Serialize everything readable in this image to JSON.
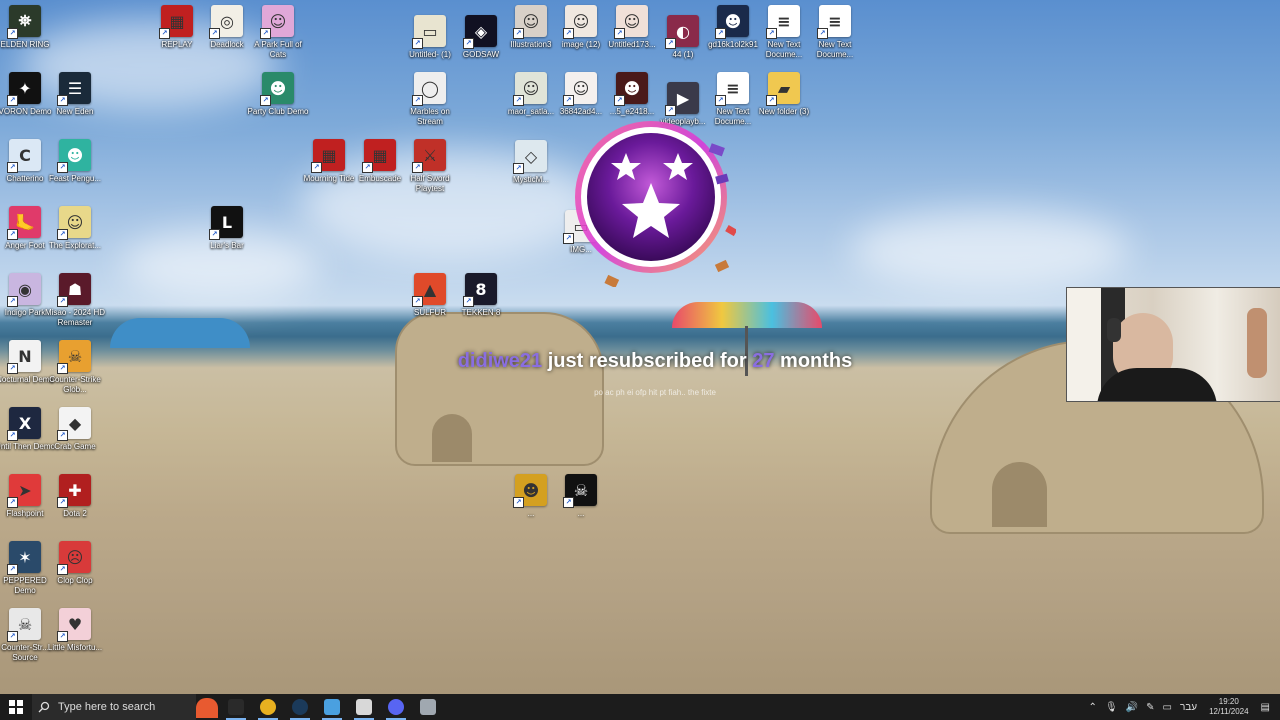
{
  "desktop_icons": [
    {
      "label": "ELDEN RING",
      "color": "#2b3a2a",
      "glyph": "⛯"
    },
    {
      "label": "VORON Demo",
      "color": "#111111",
      "glyph": "✦"
    },
    {
      "label": "New Eden",
      "color": "#1a2a3a",
      "glyph": "☰"
    },
    {
      "label": "Chatterino",
      "color": "#dbe8f5",
      "glyph": "C"
    },
    {
      "label": "Feast Pengu...",
      "color": "#2fb3a0",
      "glyph": "☻"
    },
    {
      "label": "Anger Foot",
      "color": "#e03a6a",
      "glyph": "🦶"
    },
    {
      "label": "The Explorat...",
      "color": "#e8d88a",
      "glyph": "☺"
    },
    {
      "label": "Indigo Park",
      "color": "#c9b6e0",
      "glyph": "◉"
    },
    {
      "label": "Misao - 2024 HD Remaster",
      "color": "#5a1a2a",
      "glyph": "☗"
    },
    {
      "label": "Nocturnal Demo",
      "color": "#f2f2f2",
      "glyph": "N"
    },
    {
      "label": "Counter-Strike Glob...",
      "color": "#e8a030",
      "glyph": "☠"
    },
    {
      "label": "Until Then Demo",
      "color": "#1e2840",
      "glyph": "X"
    },
    {
      "label": "Crab Game",
      "color": "#f3f3f3",
      "glyph": "◆"
    },
    {
      "label": "Flashpoint",
      "color": "#e03a3a",
      "glyph": "➤"
    },
    {
      "label": "Dota 2",
      "color": "#b11f1f",
      "glyph": "✚"
    },
    {
      "label": "PEPPERED Demo",
      "color": "#2a4a6a",
      "glyph": "✶"
    },
    {
      "label": "Clop Clop",
      "color": "#d83a3a",
      "glyph": "☹"
    },
    {
      "label": "Counter-Str... Source",
      "color": "#e8e8e8",
      "glyph": "☠"
    },
    {
      "label": "Little Misfortu...",
      "color": "#f3d0d8",
      "glyph": "♥"
    },
    {
      "label": "REPLAY",
      "color": "#c02020",
      "glyph": "▦"
    },
    {
      "label": "Deadlock",
      "color": "#f2efe6",
      "glyph": "◎"
    },
    {
      "label": "A Park Full of Cats",
      "color": "#e0a8d8",
      "glyph": "☺"
    },
    {
      "label": "Party Club Demo",
      "color": "#2a8a6a",
      "glyph": "☻"
    },
    {
      "label": "Liar's Bar",
      "color": "#111111",
      "glyph": "L"
    },
    {
      "label": "Mourning Tide",
      "color": "#c02020",
      "glyph": "▦"
    },
    {
      "label": "Embuscade",
      "color": "#c02020",
      "glyph": "▦"
    },
    {
      "label": "Half Sword Playtest",
      "color": "#c03028",
      "glyph": "⚔"
    },
    {
      "label": "SULFUR",
      "color": "#e04a2a",
      "glyph": "▲"
    },
    {
      "label": "TEKKEN 8",
      "color": "#1a1a2a",
      "glyph": "8"
    },
    {
      "label": "Untitled- (1)",
      "color": "#e8e4d0",
      "glyph": "▭"
    },
    {
      "label": "GODSAW",
      "color": "#111122",
      "glyph": "◈"
    },
    {
      "label": "Illustration3",
      "color": "#d8d0c8",
      "glyph": "☺"
    },
    {
      "label": "image (12)",
      "color": "#f0e8e0",
      "glyph": "☺"
    },
    {
      "label": "Untitled173...",
      "color": "#f0e0d8",
      "glyph": "☺"
    },
    {
      "label": "44 (1)",
      "color": "#8a2a4a",
      "glyph": "◐"
    },
    {
      "label": "gd16k1ol2k91",
      "color": "#1a2a4a",
      "glyph": "☻"
    },
    {
      "label": "New Text Docume...",
      "color": "#ffffff",
      "glyph": "≡"
    },
    {
      "label": "New Text Docume...",
      "color": "#ffffff",
      "glyph": "≡"
    },
    {
      "label": "Marbles on Stream",
      "color": "#eeeeee",
      "glyph": "◯"
    },
    {
      "label": "maor_satla...",
      "color": "#e0e4d8",
      "glyph": "☺"
    },
    {
      "label": "36842ad4...",
      "color": "#f4f0ee",
      "glyph": "☺"
    },
    {
      "label": "...5_e2418...",
      "color": "#4a1a1a",
      "glyph": "☻"
    },
    {
      "label": "videoplayb...",
      "color": "#3a3a4a",
      "glyph": "▶"
    },
    {
      "label": "New Text Docume...",
      "color": "#ffffff",
      "glyph": "≡"
    },
    {
      "label": "New folder (3)",
      "color": "#f0c850",
      "glyph": "▰"
    },
    {
      "label": "MysticM...",
      "color": "#dde8ee",
      "glyph": "◇"
    },
    {
      "label": "IMG...",
      "color": "#eeeeee",
      "glyph": "▭"
    },
    {
      "label": "...",
      "color": "#d4a020",
      "glyph": "☻"
    },
    {
      "label": "...",
      "color": "#111111",
      "glyph": "☠"
    }
  ],
  "alert": {
    "username": "didiwe21",
    "text_before": " just resubscribed for ",
    "months": "27",
    "text_after": " months",
    "message": "po ac ph ei ofp hit pt fiah.. the fixte"
  },
  "taskbar": {
    "search_placeholder": "Type here to search",
    "apps": [
      {
        "name": "obs",
        "color": "#2a2a2a"
      },
      {
        "name": "chrome",
        "color": "#e8b020"
      },
      {
        "name": "steam",
        "color": "#1b3a5a"
      },
      {
        "name": "chatterino",
        "color": "#4aa0e0"
      },
      {
        "name": "notes",
        "color": "#d8d8d8"
      },
      {
        "name": "discord",
        "color": "#5865f2"
      },
      {
        "name": "app7",
        "color": "#a0a8b0"
      }
    ],
    "lang": "עבר",
    "time": "19:20",
    "date": "12/11/2024"
  }
}
